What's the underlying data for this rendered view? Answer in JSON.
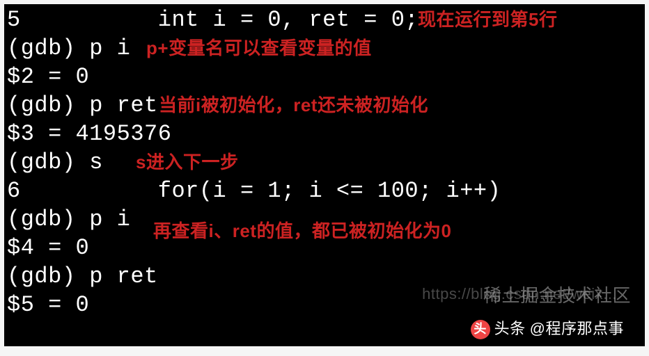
{
  "terminal": {
    "lines": [
      "5          int i = 0, ret = 0;",
      "(gdb) p i",
      "$2 = 0",
      "(gdb) p ret",
      "$3 = 4195376",
      "(gdb) s",
      "6          for(i = 1; i <= 100; i++)",
      "(gdb) p i",
      "$4 = 0",
      "(gdb) p ret",
      "$5 = 0"
    ]
  },
  "annotations": {
    "a1": "现在运行到第5行",
    "a2": "p+变量名可以查看变量的值",
    "a3": "当前i被初始化，ret还未被初始化",
    "a4": "s进入下一步",
    "a5": "再查看i、ret的值，都已被初始化为0"
  },
  "watermark1": "https://blog.csdn.net/weix...",
  "watermark2": "稀土掘金技术社区",
  "footer": {
    "icon": "头",
    "prefix": "头条",
    "text": "@程序那点事"
  }
}
